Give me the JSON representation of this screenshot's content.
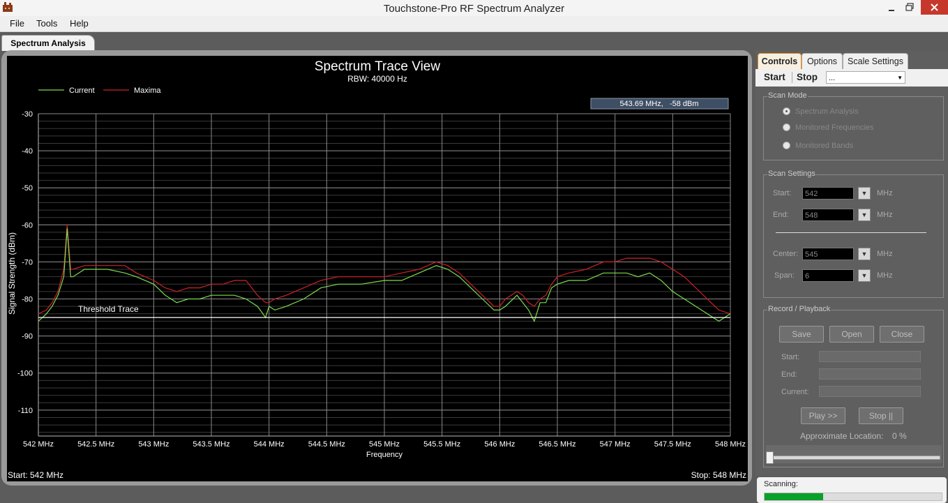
{
  "window": {
    "title": "Touchstone-Pro RF Spectrum Analyzer"
  },
  "menu": [
    "File",
    "Tools",
    "Help"
  ],
  "main_tab": "Spectrum Analysis",
  "chart_data": {
    "type": "line",
    "title": "Spectrum Trace View",
    "subtitle": "RBW: 40000 Hz",
    "xlabel": "Frequency",
    "ylabel": "Signal Strength (dBm)",
    "xlim": [
      542,
      548
    ],
    "ylim": [
      -117,
      -30
    ],
    "x_ticks": [
      542,
      542.5,
      543,
      543.5,
      544,
      544.5,
      545,
      545.5,
      546,
      546.5,
      547,
      547.5,
      548
    ],
    "x_tick_labels": [
      "542 MHz",
      "542.5 MHz",
      "543 MHz",
      "543.5 MHz",
      "544 MHz",
      "544.5 MHz",
      "545 MHz",
      "545.5 MHz",
      "546 MHz",
      "546.5 MHz",
      "547 MHz",
      "547.5 MHz",
      "548 MHz"
    ],
    "y_ticks": [
      -30,
      -40,
      -50,
      -60,
      -70,
      -80,
      -90,
      -100,
      -110
    ],
    "y_tick_labels": [
      "-30",
      "-40",
      "-50",
      "-60",
      "-70",
      "-80",
      "-90",
      "-100",
      "-110"
    ],
    "grid": true,
    "legend": "top-left",
    "series": [
      {
        "name": "Current",
        "color": "#7ddc4e",
        "x": [
          542,
          542.07,
          542.12,
          542.17,
          542.22,
          542.25,
          542.28,
          542.3,
          542.4,
          542.5,
          542.6,
          542.75,
          542.85,
          543,
          543.1,
          543.2,
          543.3,
          543.4,
          543.5,
          543.6,
          543.7,
          543.8,
          543.9,
          543.97,
          544,
          544.05,
          544.15,
          544.3,
          544.45,
          544.6,
          544.8,
          545,
          545.15,
          545.3,
          545.45,
          545.55,
          545.65,
          545.75,
          545.85,
          545.95,
          546,
          546.05,
          546.15,
          546.2,
          546.25,
          546.3,
          546.35,
          546.4,
          546.45,
          546.5,
          546.6,
          546.75,
          546.9,
          547,
          547.1,
          547.2,
          547.3,
          547.4,
          547.5,
          547.6,
          547.7,
          547.8,
          547.9,
          548
        ],
        "values": [
          -86,
          -84,
          -82,
          -79,
          -74,
          -61,
          -74,
          -74,
          -72,
          -72,
          -72,
          -73,
          -74,
          -76,
          -79,
          -81,
          -80,
          -80,
          -79,
          -79,
          -79,
          -80,
          -82,
          -85,
          -82,
          -83,
          -82,
          -80,
          -77,
          -76,
          -76,
          -75,
          -75,
          -73,
          -71,
          -72,
          -74,
          -77,
          -80,
          -83,
          -83,
          -82,
          -79,
          -81,
          -83,
          -86,
          -81,
          -81,
          -77,
          -76,
          -75,
          -75,
          -73,
          -73,
          -73,
          -74,
          -73,
          -75,
          -78,
          -80,
          -82,
          -84,
          -86,
          -84
        ]
      },
      {
        "name": "Maxima",
        "color": "#d0202a",
        "x": [
          542,
          542.07,
          542.12,
          542.17,
          542.22,
          542.25,
          542.28,
          542.3,
          542.4,
          542.5,
          542.6,
          542.75,
          542.85,
          543,
          543.1,
          543.2,
          543.3,
          543.4,
          543.5,
          543.6,
          543.7,
          543.8,
          543.9,
          543.97,
          544,
          544.05,
          544.15,
          544.3,
          544.45,
          544.6,
          544.8,
          545,
          545.15,
          545.3,
          545.45,
          545.55,
          545.65,
          545.75,
          545.85,
          545.95,
          546,
          546.05,
          546.15,
          546.2,
          546.25,
          546.3,
          546.35,
          546.4,
          546.45,
          546.5,
          546.6,
          546.75,
          546.9,
          547,
          547.1,
          547.2,
          547.3,
          547.4,
          547.5,
          547.6,
          547.7,
          547.8,
          547.9,
          548
        ],
        "values": [
          -84,
          -83,
          -81,
          -78,
          -72,
          -60,
          -72,
          -72,
          -71,
          -71,
          -71,
          -71,
          -73,
          -75,
          -77,
          -78,
          -77,
          -77,
          -76,
          -76,
          -75,
          -75,
          -79,
          -81,
          -81,
          -80,
          -79,
          -77,
          -75,
          -74,
          -74,
          -74,
          -73,
          -72,
          -70,
          -71,
          -73,
          -76,
          -79,
          -82,
          -82,
          -80,
          -78,
          -79,
          -81,
          -82,
          -80,
          -79,
          -76,
          -74,
          -73,
          -72,
          -70,
          -70,
          -69,
          -69,
          -69,
          -70,
          -72,
          -74,
          -77,
          -80,
          -83,
          -84
        ]
      },
      {
        "name": "Threshold Trace",
        "color": "#ffffff",
        "x": [
          542,
          548
        ],
        "values": [
          -85,
          -85
        ]
      }
    ],
    "annotations": [
      "Threshold Trace"
    ],
    "cursor_readout": "543.69 MHz,   -58 dBm",
    "start_label": "Start: 542 MHz",
    "stop_label": "Stop: 548 MHz"
  },
  "panel": {
    "tabs": [
      "Controls",
      "Options",
      "Scale Settings"
    ],
    "toolbar": {
      "start": "Start",
      "stop": "Stop",
      "preset": "..."
    },
    "scan_mode": {
      "title": "Scan Mode",
      "options": [
        "Spectrum Analysis",
        "Monitored Frequencies",
        "Monitored Bands"
      ],
      "selected": "Spectrum Analysis"
    },
    "scan_settings": {
      "title": "Scan Settings",
      "start_label": "Start:",
      "start_value": "542",
      "end_label": "End:",
      "end_value": "548",
      "center_label": "Center:",
      "center_value": "545",
      "span_label": "Span:",
      "span_value": "6",
      "unit": "MHz"
    },
    "record": {
      "title": "Record / Playback",
      "save": "Save",
      "open": "Open",
      "close": "Close",
      "start_label": "Start:",
      "end_label": "End:",
      "current_label": "Current:",
      "play": "Play >>",
      "stop": "Stop ||",
      "location_label": "Approximate Location:",
      "location_value": "0 %"
    },
    "status": {
      "label": "Scanning:",
      "progress": 0.33,
      "color": "#0aa02a"
    }
  }
}
